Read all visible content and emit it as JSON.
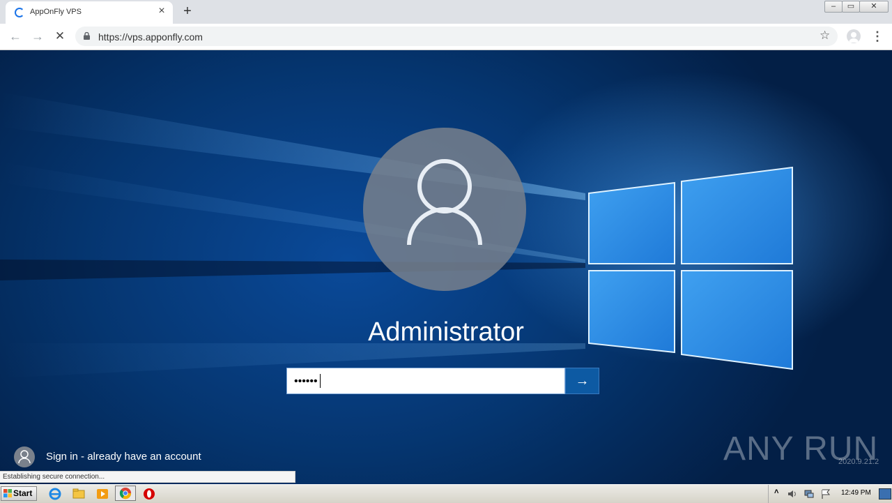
{
  "browser": {
    "tab": {
      "title": "AppOnFly VPS",
      "close_icon": "close-icon"
    },
    "new_tab_label": "+",
    "address": {
      "url": "https://vps.apponfly.com"
    },
    "window_controls": {
      "minimize": "–",
      "maximize": "▭",
      "close": "✕"
    }
  },
  "login": {
    "username": "Administrator",
    "password_masked": "••••••",
    "submit_icon": "→",
    "alt_signin": "Sign in - already have an account",
    "accent_color": "#0d5aa3"
  },
  "watermark": {
    "brand": "ANY RUN",
    "version": "2020.9.21.2"
  },
  "status_bar": {
    "text": "Establishing secure connection..."
  },
  "taskbar": {
    "start_label": "Start",
    "clock": "12:49 PM",
    "pinned": [
      "ie-icon",
      "explorer-icon",
      "media-player-icon",
      "chrome-icon",
      "opera-icon"
    ]
  }
}
